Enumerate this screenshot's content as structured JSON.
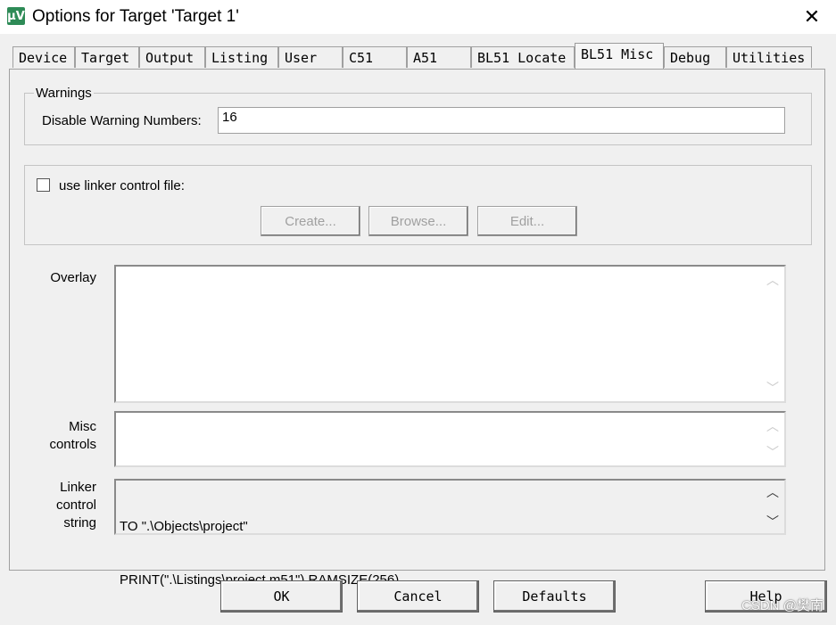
{
  "window": {
    "title": "Options for Target 'Target 1'",
    "icon": "app-icon",
    "close_icon": "close-icon"
  },
  "tabs": [
    {
      "label": "Device"
    },
    {
      "label": "Target"
    },
    {
      "label": "Output"
    },
    {
      "label": "Listing"
    },
    {
      "label": "User"
    },
    {
      "label": "C51"
    },
    {
      "label": "A51"
    },
    {
      "label": "BL51 Locate"
    },
    {
      "label": "BL51 Misc",
      "active": true
    },
    {
      "label": "Debug"
    },
    {
      "label": "Utilities"
    }
  ],
  "warnings": {
    "group_label": "Warnings",
    "field_label": "Disable Warning Numbers:",
    "value": "16"
  },
  "linker_file": {
    "checkbox_label": "use linker control file:",
    "checked": false,
    "buttons": {
      "create": "Create...",
      "browse": "Browse...",
      "edit": "Edit..."
    }
  },
  "overlay": {
    "label": "Overlay",
    "value": ""
  },
  "misc": {
    "label_line1": "Misc",
    "label_line2": "controls",
    "value": ""
  },
  "linker_string": {
    "label_line1": "Linker",
    "label_line2": "control",
    "label_line3": "string",
    "line1": "TO \".\\Objects\\project\"",
    "line2": "PRINT(\".\\Listings\\project.m51\") RAMSIZE(256)"
  },
  "footer": {
    "ok": "OK",
    "cancel": "Cancel",
    "defaults": "Defaults",
    "help": "Help"
  },
  "watermark": "CSDN @樊南",
  "colors": {
    "panel_bg": "#f0f0f0",
    "border": "#a0a0a0",
    "disabled_text": "#a0a0a0"
  }
}
